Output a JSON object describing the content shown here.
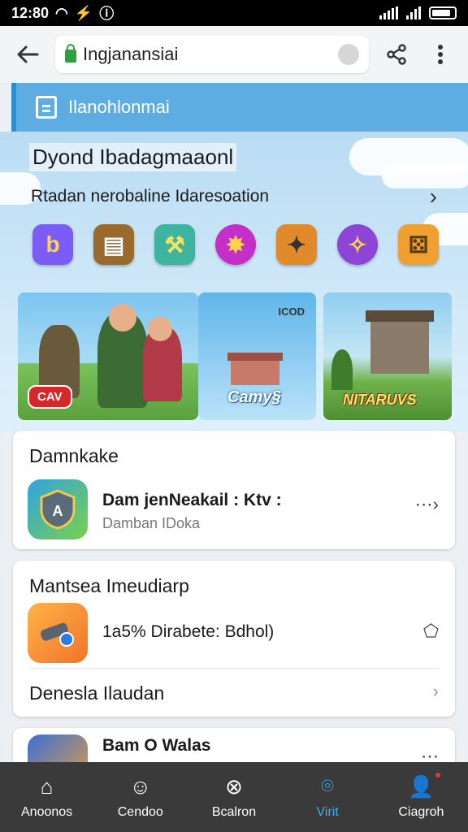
{
  "status_bar": {
    "time": "12:80"
  },
  "browser": {
    "url_text": "Ingjanansiai",
    "back_glyph": "←",
    "share_glyph": "⋖",
    "menu_glyph": "⋮"
  },
  "site_header": {
    "title": "Ilanohlonmai"
  },
  "hero": {
    "title": "Dyond Ibadagmaaonl",
    "subtitle": "Rtadan nerobaline Idaresoation",
    "chevron": "›",
    "game_icons": [
      {
        "name": "b-app-icon",
        "glyph": "b",
        "color": "#7b5cf5"
      },
      {
        "name": "barrel-game-icon",
        "glyph": "▤",
        "color": "#9a6a2c"
      },
      {
        "name": "hammer-game-icon",
        "glyph": "⚒",
        "color": "#3cb4a0"
      },
      {
        "name": "star-game-icon",
        "glyph": "✸",
        "color": "#c42fc8"
      },
      {
        "name": "gun-game-icon",
        "glyph": "✦",
        "color": "#e08a2c"
      },
      {
        "name": "magic-game-icon",
        "glyph": "✧",
        "color": "#8e44d6"
      },
      {
        "name": "dice-game-icon",
        "glyph": "⚄",
        "color": "#f0a030"
      }
    ],
    "banners": {
      "a_chip": "CAV",
      "b_top": "ICOD",
      "b_label": "Camy§",
      "c_label": "NITARUVS"
    }
  },
  "card_downloads": {
    "title": "Damnkake",
    "app_name": "Dam jenNeakail : Ktv :",
    "app_sub": "Damban IDoka",
    "action": "⋯›"
  },
  "card_manage": {
    "title": "Mantsea Imeudiarp",
    "app_text": "1a5% Dirabete: Bdhol)",
    "action": "⬠",
    "link_text": "Denesla Ilaudan",
    "link_chevron": "›"
  },
  "card_partial": {
    "app_name": "Bam O Walas",
    "action": "⋯"
  },
  "bottom_nav": [
    {
      "key": "home",
      "label": "Anoonos",
      "glyph": "⌂",
      "active": false
    },
    {
      "key": "games",
      "label": "Cendoo",
      "glyph": "☺",
      "active": false
    },
    {
      "key": "search",
      "label": "Bcalron",
      "glyph": "⊗",
      "active": false
    },
    {
      "key": "visit",
      "label": "Virit",
      "glyph": "⌾",
      "active": true
    },
    {
      "key": "profile",
      "label": "Ciagroh",
      "glyph": "👤",
      "active": false
    }
  ],
  "colors": {
    "accent": "#3ab0f0",
    "header_blue": "#5dade2",
    "nav_bg": "#3a3a3a"
  }
}
